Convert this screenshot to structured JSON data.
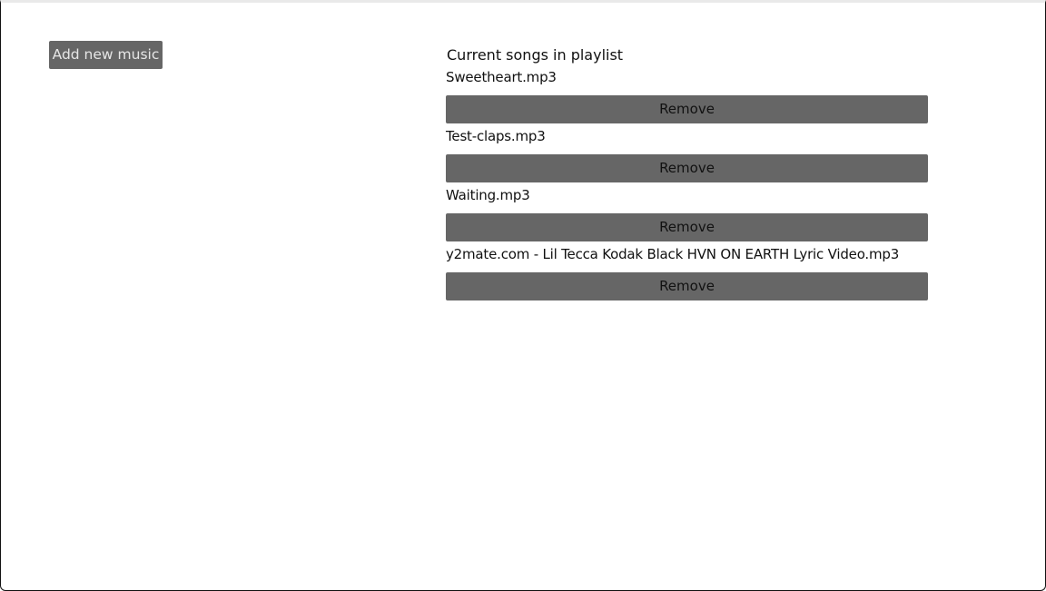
{
  "add_button": {
    "label": "Add new music"
  },
  "playlist": {
    "title": "Current songs in playlist",
    "songs": [
      {
        "name": "Sweetheart.mp3",
        "remove_label": "Remove"
      },
      {
        "name": "Test-claps.mp3",
        "remove_label": "Remove"
      },
      {
        "name": "Waiting.mp3",
        "remove_label": "Remove"
      },
      {
        "name": "y2mate.com - Lil Tecca  Kodak Black  HVN ON EARTH Lyric Video.mp3",
        "remove_label": "Remove"
      }
    ]
  },
  "colors": {
    "button_bg": "#666666",
    "add_button_text": "#e6e6e6",
    "text": "#111111",
    "background": "#ffffff"
  }
}
